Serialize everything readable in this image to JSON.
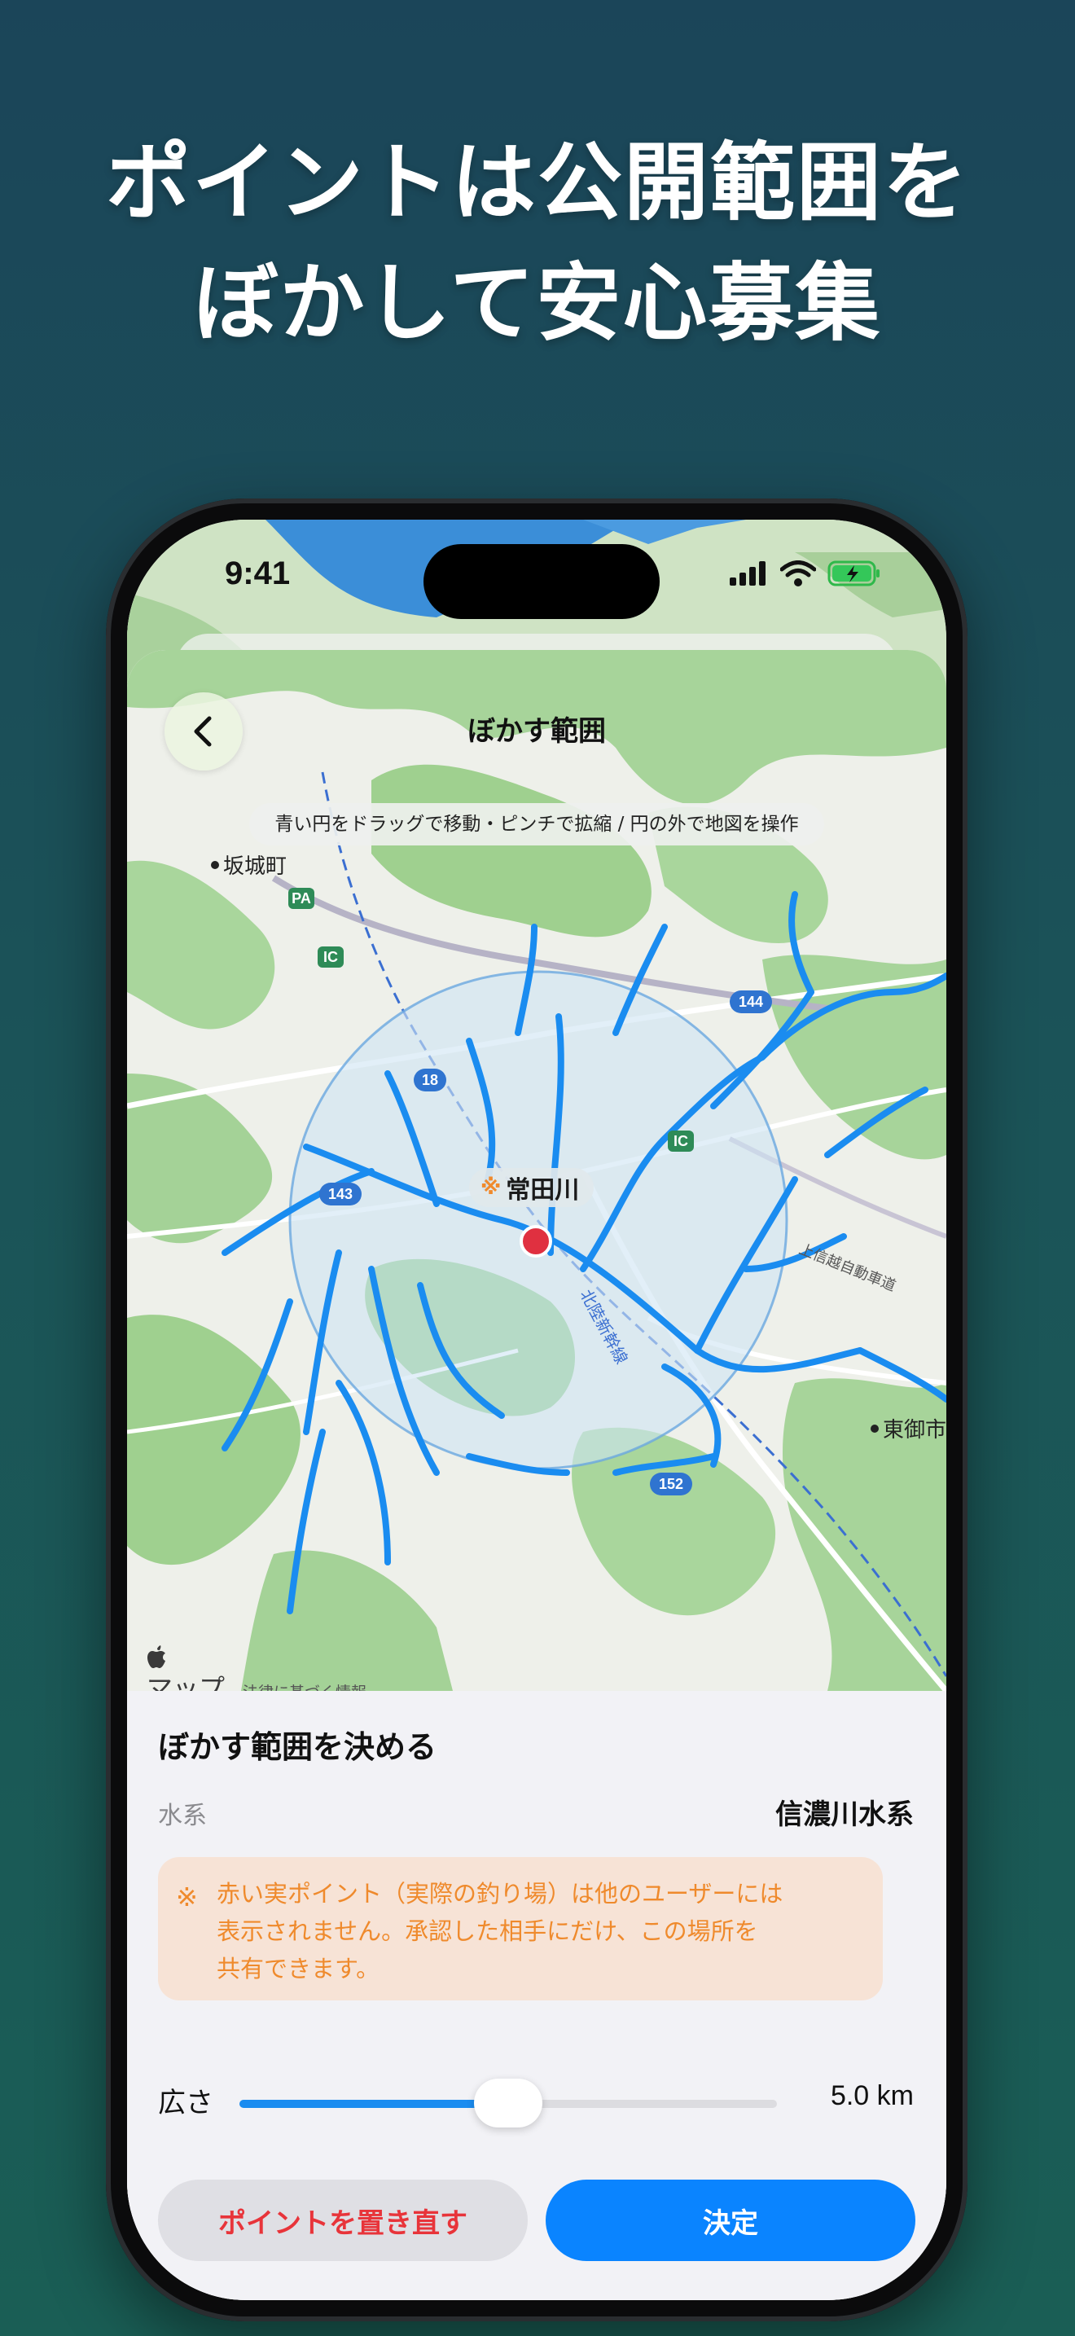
{
  "headline": {
    "line1": "ポイントは公開範囲を",
    "line2": "ぼかして安心募集"
  },
  "status_bar": {
    "time": "9:41",
    "icons": [
      "cellular-signal-icon",
      "wifi-icon",
      "battery-charging-icon"
    ]
  },
  "nav": {
    "title": "ぼかす範囲",
    "back_icon": "chevron-left-icon"
  },
  "map": {
    "hint": "青い円をドラッグで移動・ピンチで拡縮 / 円の外で地図を操作",
    "place_marker": "※",
    "place_name": "常田川",
    "town_labels": [
      "坂城町",
      "東御市"
    ],
    "road_badges": [
      "PA",
      "IC",
      "IC",
      "144",
      "18",
      "143",
      "152"
    ],
    "rail_label": "北陸新幹線",
    "expressway_label": "上信越自動車道",
    "credit_logo": "マップ",
    "credit_legal": "法律に基づく情報",
    "colors": {
      "river": "#1a8cf0",
      "circle_fill": "#cfe4f3",
      "point": "#e03040"
    }
  },
  "panel": {
    "title": "ぼかす範囲を決める",
    "system_label": "水系",
    "system_value": "信濃川水系",
    "notice_marker": "※",
    "notice_lines": [
      "赤い実ポイント（実際の釣り場）は他のユーザーには",
      "表示されません。承認した相手にだけ、この場所を",
      "共有できます。"
    ],
    "width_label": "広さ",
    "width_value": "5.0 km",
    "slider_level": 0.5,
    "reset_button": "ポイントを置き直す",
    "confirm_button": "決定",
    "colors": {
      "accent": "#0a84ff",
      "danger": "#e8343a",
      "notice_bg": "#f7e3d6",
      "notice_text": "#ef8a2c"
    }
  }
}
